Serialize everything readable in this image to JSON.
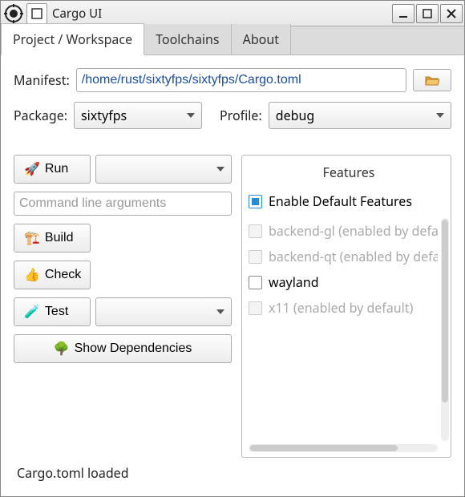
{
  "window": {
    "title": "Cargo UI"
  },
  "tabs": [
    {
      "label": "Project / Workspace",
      "active": true
    },
    {
      "label": "Toolchains",
      "active": false
    },
    {
      "label": "About",
      "active": false
    }
  ],
  "manifest": {
    "label": "Manifest:",
    "value": "/home/rust/sixtyfps/sixtyfps/Cargo.toml",
    "browse_icon": "folder-open-icon"
  },
  "package": {
    "label": "Package:",
    "value": "sixtyfps"
  },
  "profile": {
    "label": "Profile:",
    "value": "debug"
  },
  "actions": {
    "run": {
      "label": "Run",
      "icon": "rocket-icon",
      "dropdown_value": ""
    },
    "args_placeholder": "Command line arguments",
    "args_value": "",
    "build": {
      "label": "Build",
      "icon": "crane-icon"
    },
    "check": {
      "label": "Check",
      "icon": "thumbs-up-icon"
    },
    "test": {
      "label": "Test",
      "icon": "test-tube-icon",
      "dropdown_value": ""
    },
    "deps": {
      "label": "Show Dependencies",
      "icon": "tree-icon"
    }
  },
  "features": {
    "title": "Features",
    "enable_default_label": "Enable Default Features",
    "enable_default_checked": true,
    "items": [
      {
        "label": "backend-gl (enabled by default)",
        "checked": false,
        "disabled": true
      },
      {
        "label": "backend-qt (enabled by default)",
        "checked": false,
        "disabled": true
      },
      {
        "label": "wayland",
        "checked": false,
        "disabled": false
      },
      {
        "label": "x11 (enabled by default)",
        "checked": false,
        "disabled": true
      }
    ]
  },
  "status": "Cargo.toml loaded"
}
